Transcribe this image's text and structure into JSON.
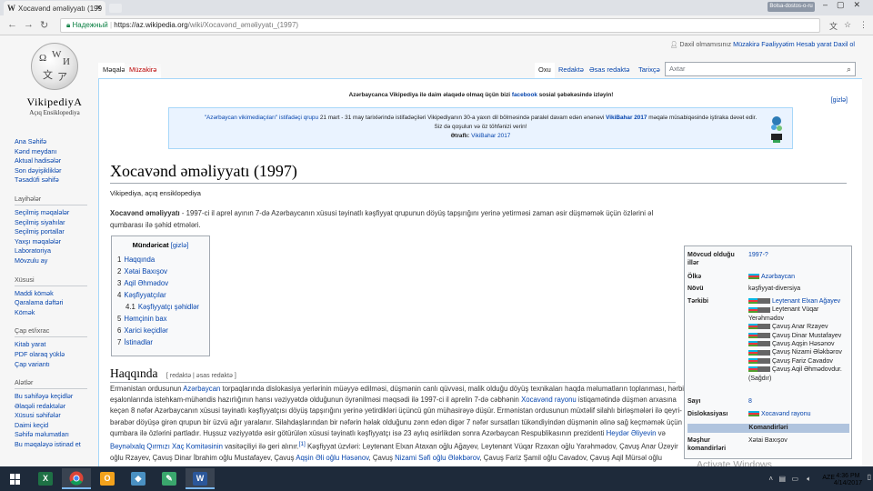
{
  "browser": {
    "tab_title": "Xocavənd əməliyyatı (199",
    "profile_label": "Bolsa-dostos-o-ru",
    "url_secure_label": "Надежный",
    "url_host": "https://az.wikipedia.org",
    "url_path": "/wiki/Xocavənd_əməliyyatı_(1997)"
  },
  "logo": {
    "name": "VikipediyA",
    "tagline": "Açıq Ensiklopediya"
  },
  "personal": {
    "anon": "Daxil olmamısınız",
    "talk": "Müzakirə",
    "contributions": "Fəaliyyətim",
    "create_account": "Hesab yarat",
    "login": "Daxil ol"
  },
  "tabs": {
    "article": "Məqalə",
    "talk": "Müzakirə",
    "read": "Oxu",
    "edit": "Redaktə",
    "edit_source": "Əsas redaktə",
    "history": "Tarixçə",
    "search_placeholder": "Axtar"
  },
  "sidebar": {
    "main": [
      "Ana Səhifə",
      "Kənd meydanı",
      "Aktual hadisələr",
      "Son dəyişikliklər",
      "Təsadüfi səhifə"
    ],
    "projects_title": "Layihələr",
    "projects": [
      "Seçilmiş məqalələr",
      "Seçilmiş siyahılar",
      "Seçilmiş portallar",
      "Yaxşı məqalələr",
      "Laboratoriya",
      "Mövzulu ay"
    ],
    "special_title": "Xüsusi",
    "special": [
      "Maddi kömək",
      "Qaralama dəftəri",
      "Kömək"
    ],
    "print_title": "Çap et/ixrac",
    "print": [
      "Kitab yarat",
      "PDF olaraq yüklə",
      "Çap variantı"
    ],
    "tools_title": "Alətlər",
    "tools": [
      "Bu səhifəyə keçidlər",
      "Əlaqəli redaktələr",
      "Xüsusi səhifələr",
      "Daimi keçid",
      "Səhifə məlumatları",
      "Bu məqaləyə istinad et"
    ]
  },
  "notices": {
    "fb_prefix": "Azərbaycanca Vikipediya ilə daim əlaqədə olmaq üçün bizi",
    "fb_link": "facebook",
    "fb_suffix": "sosial şəbəkəsində izləyin!",
    "edit_link": "[gizlə]",
    "banner_line1_link": "\"Azərbaycan vikimediaçıları\" istifadəçi qrupu",
    "banner_line1_text": "21 mart - 31 may tarixlərində istifadəçiləri Vikipediyanın 30-a yaxın dil bölməsində paralel davam edən ənənəvi",
    "banner_line1_bold": "VikiBahar 2017",
    "banner_line1_end": "məqalə müsabiqəsində iştiraka dəvət edir.",
    "banner_line2": "Siz də qoşulun və öz töhfənizi verin!",
    "banner_line3_label": "Ətraflı:",
    "banner_line3_link": "VikiBahar 2017"
  },
  "article": {
    "title": "Xocavənd əməliyyatı (1997)",
    "site_sub": "Vikipediya, açıq ensiklopediya",
    "lead_bold": "Xocavənd əməliyyatı",
    "lead_text": " - 1997-ci il aprel ayının 7-də Azərbaycanın xüsusi təyinatlı kəşfiyyat qrupunun döyüş tapşırığını yerinə yetirməsi zaman əsir düşməmək üçün özlərini əl qumbarası ilə şəhid etmələri.",
    "toc_title": "Mündəricat",
    "toc_hide": "[gizlə]",
    "toc": [
      {
        "num": "1",
        "label": "Haqqında",
        "sub": false
      },
      {
        "num": "2",
        "label": "Xətai Baxışov",
        "sub": false
      },
      {
        "num": "3",
        "label": "Aqil Əhmədov",
        "sub": false
      },
      {
        "num": "4",
        "label": "Kəşfiyyatçılar",
        "sub": false
      },
      {
        "num": "4.1",
        "label": "Kəşfiyyatçı şəhidlər",
        "sub": true
      },
      {
        "num": "5",
        "label": "Həmçinin bax",
        "sub": false
      },
      {
        "num": "6",
        "label": "Xarici keçidlər",
        "sub": false
      },
      {
        "num": "7",
        "label": "İstinadlar",
        "sub": false
      }
    ],
    "section_heading": "Haqqında",
    "section_edit": "[ redaktə | əsas redaktə ]",
    "body": {
      "p1": "Ermənistan ordusunun ",
      "l1": "Azərbaycan",
      "p2": " torpaqlarında dislokasiya yerlərinin müəyyə edilməsi, düşmənin canlı qüvvəsi, malik olduğu döyüş texnikaları haqda məlumatların toplanması, hərbi eşalonlarında istehkam-mühəndis hazırlığının hansı vəziyyətdə olduğunun öyrənilməsi məqsədi ilə 1997-ci il aprelin 7-də cəbhənin ",
      "l2": "Xocavənd rayonu",
      "p3": " istiqamətində düşmən arxasına keçən 8 nəfər Azərbaycanın xüsusi təyinatlı kəşfiyyatçısı döyüş tapşırığını yerinə yetirdikləri üçüncü gün mühasirəyə düşür. Ermənistan ordusunun müxtəlif silahlı birləşmələri ilə qeyri-bərabər döyüşə girən qrupun bir üzvü ağır yaralanır. Silahdaşlarından bir nəfərin həlak olduğunu zənn edən digər 7 nəfər sursatları tükəndiyindən düşmənin əlinə sağ keçməmək üçün qumbara ilə özlərini partladır. Huşsuz vəziyyətdə əsir götürülən xüsusi təyinatlı kəşfiyyatçı isə 23 aylıq əsirlikdən sonra Azərbaycan Respublikasının prezidenti ",
      "l3": "Heydər Əliyevin",
      "p4": " və ",
      "l4": "Beynəlxalq Qırmızı Xaç Komitəsinin",
      "p5": " vasitəçiliyi ilə geri alınır.",
      "ref": "[1]",
      "p6": " Kəşfiyyat üzvləri: Leytenant Elxan Ataxan oğlu Ağayev, Leytenant Vüqar Rzaxan oğlu Yarəhmədov, Çavuş Anar Üzeyir oğlu Rzayev, Çavuş Dinar İbrahim oğlu Mustafayev, Çavuş ",
      "l5": "Aqşin Əli oğlu Həsənov",
      "p7": ", Çavuş ",
      "l6": "Nizami Səfi oğlu Ələkbərov",
      "p8": ", Çavuş Fariz Şamil oğlu Cavadov, Çavuş Aqil Mürsəl oğlu"
    }
  },
  "infobox": {
    "date_label": "Mövcud olduğu illər",
    "date_value": "1997-?",
    "country_label": "Ölkə",
    "country_value": "Azərbaycan",
    "type_label": "Növü",
    "type_value": "kəşfiyyat-diversiya",
    "members_label": "Tərkibi",
    "members": [
      {
        "text": "Leytenant Elxan Ağayev",
        "link": true
      },
      {
        "text": "Leytenant Vüqar Yerəhmədov",
        "link": false
      },
      {
        "text": "Çavuş Anar Rzayev",
        "link": false
      },
      {
        "text": "Çavuş Dinar Mustafayev",
        "link": false
      },
      {
        "text": "Çavuş Aqşin Həsənov",
        "link": false
      },
      {
        "text": "Çavuş Nizami Ələkbərov",
        "link": false
      },
      {
        "text": "Çavuş Fariz Cavadov",
        "link": false
      },
      {
        "text": "Çavuş Aqil Əhmədovdur. (Sağdır)",
        "link": false
      }
    ],
    "count_label": "Sayı",
    "count_value": "8",
    "disloc_label": "Dislokasiyası",
    "disloc_value": "Xocavənd rayonu",
    "commanders_header": "Komandirləri",
    "commander_label": "Məşhur komandirləri",
    "commander_value": "Xətai Baxışov"
  },
  "watermark": {
    "line1": "Activate Windows",
    "line2": "Go to Settings to activate Windows."
  },
  "taskbar": {
    "lang": "AZE",
    "time": "4:36 PM",
    "date": "4/14/2017"
  },
  "colors": {
    "link": "#0645ad",
    "redlink": "#ba0000",
    "taskbar": "#1e2a3a"
  }
}
